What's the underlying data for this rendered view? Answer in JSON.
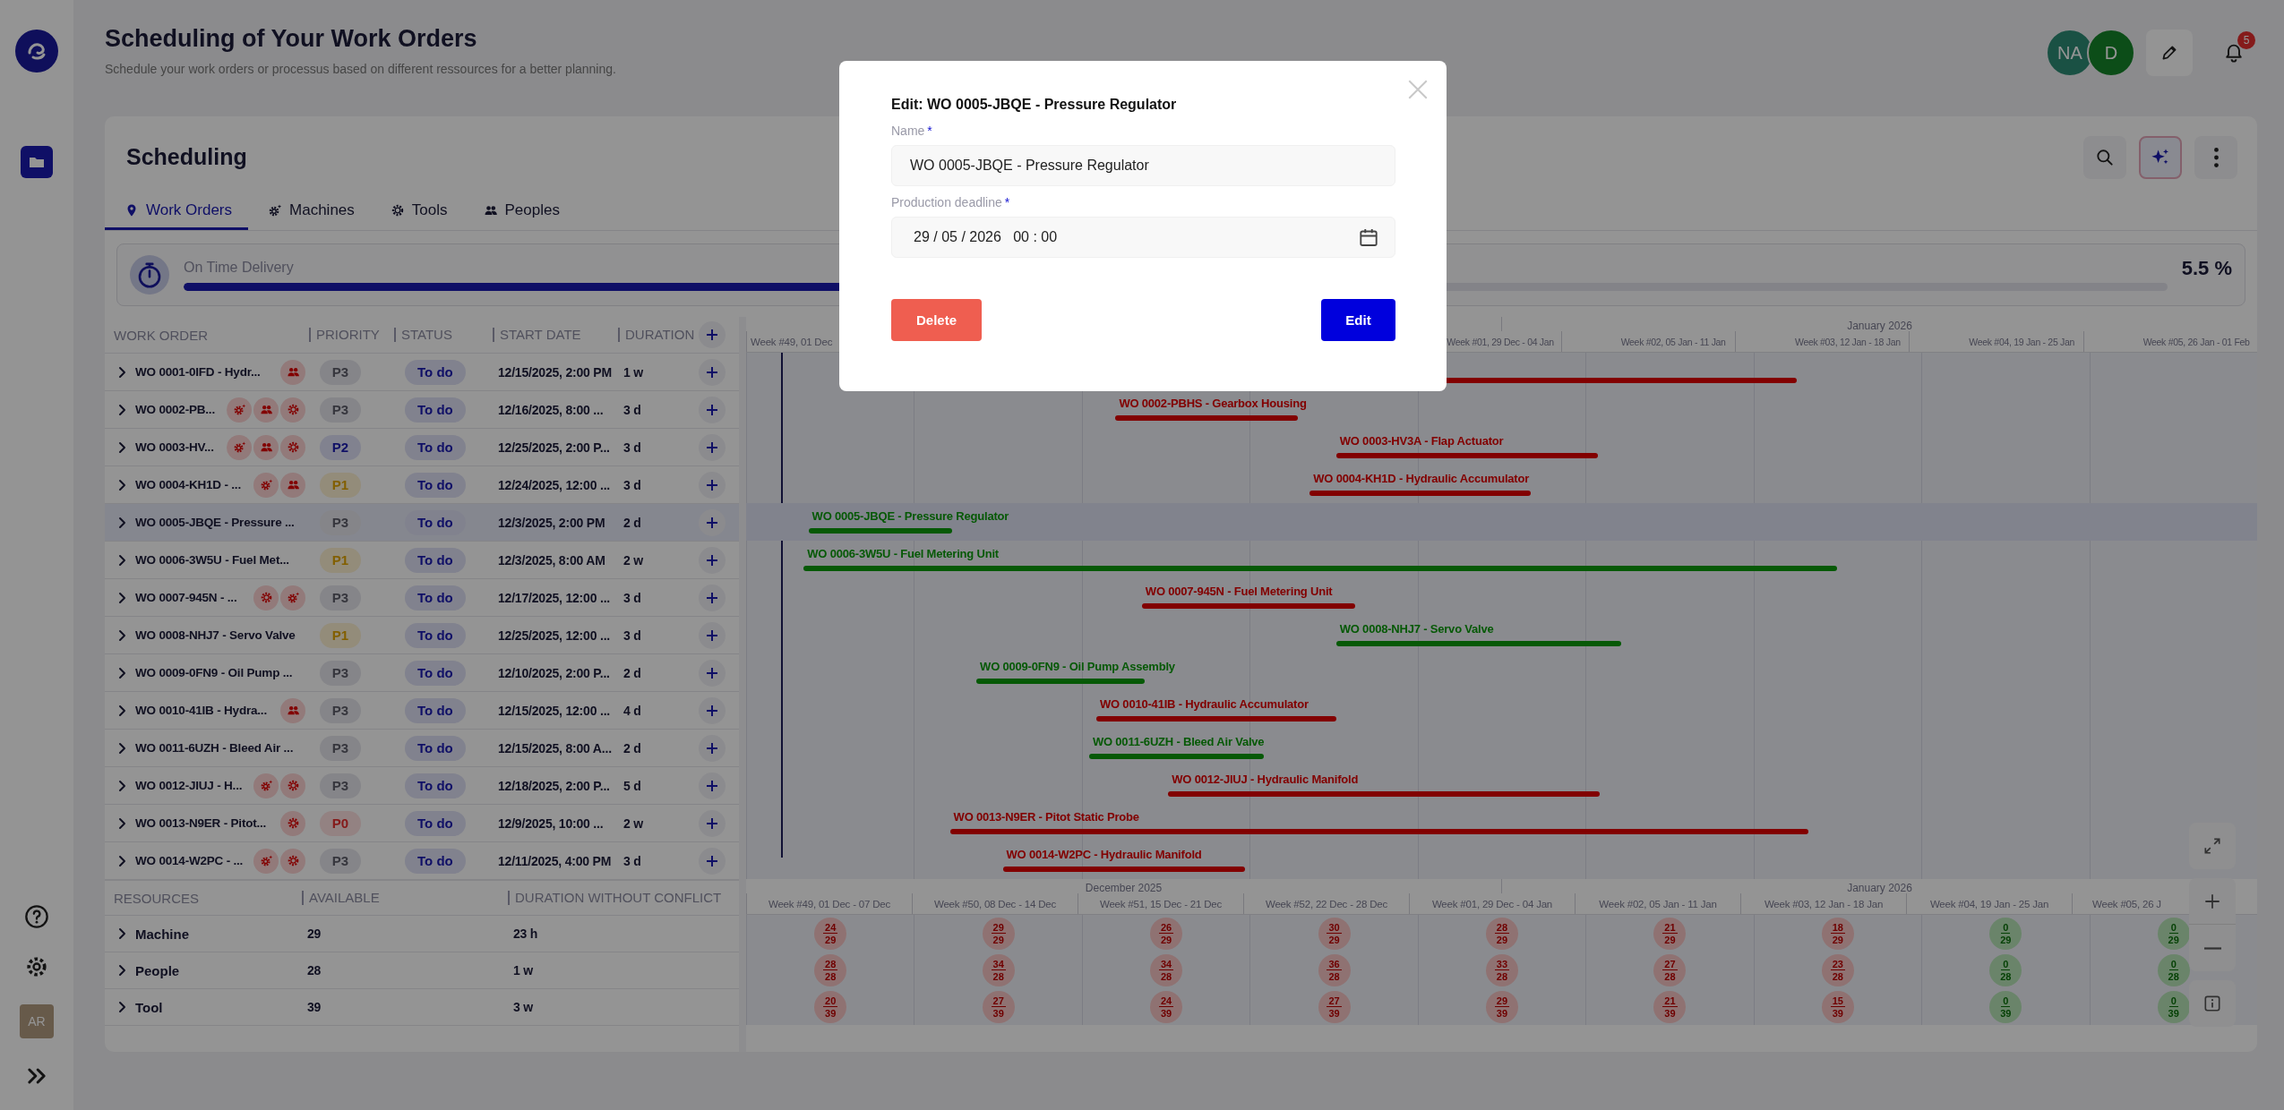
{
  "sidebar": {
    "avatar": "AR"
  },
  "header": {
    "title": "Scheduling of Your Work Orders",
    "subtitle": "Schedule your work orders or processus based on different ressources for a better planning.",
    "users": [
      {
        "initials": "NA"
      },
      {
        "initials": "D"
      }
    ],
    "notifications": "5"
  },
  "scheduling": {
    "title": "Scheduling",
    "tabs": [
      {
        "label": "Work Orders",
        "kind": "pin",
        "selected": true
      },
      {
        "label": "Machines",
        "kind": "machine",
        "selected": false
      },
      {
        "label": "Tools",
        "kind": "tool",
        "selected": false
      },
      {
        "label": "Peoples",
        "kind": "people",
        "selected": false
      }
    ],
    "on_time_delivery": {
      "label": "On Time Delivery",
      "level": 0.42,
      "reading": "5.5 %"
    },
    "work_orders": {
      "columns": [
        "WORK ORDER",
        "PRIORITY",
        "STATUS",
        "START DATE",
        "DURATION"
      ],
      "rows": [
        {
          "name": "WO 0001-0IFD - Hydr...",
          "resources": [
            {
              "kind": "people"
            }
          ],
          "priority": {
            "label": "P3",
            "kind": "low"
          },
          "status": "To do",
          "start": "12/15/2025, 2:00 PM",
          "duration": "1 w",
          "selected": false
        },
        {
          "name": "WO 0002-PB...",
          "resources": [
            {
              "kind": "machine"
            },
            {
              "kind": "people"
            },
            {
              "kind": "tool"
            }
          ],
          "priority": {
            "label": "P3",
            "kind": "low"
          },
          "status": "To do",
          "start": "12/16/2025, 8:00 ...",
          "duration": "3 d",
          "selected": false
        },
        {
          "name": "WO 0003-HV...",
          "resources": [
            {
              "kind": "machine"
            },
            {
              "kind": "people"
            },
            {
              "kind": "tool"
            }
          ],
          "priority": {
            "label": "P2",
            "kind": "medium"
          },
          "status": "To do",
          "start": "12/25/2025, 2:00 P...",
          "duration": "3 d",
          "selected": false
        },
        {
          "name": "WO 0004-KH1D - ...",
          "resources": [
            {
              "kind": "machine"
            },
            {
              "kind": "people"
            }
          ],
          "priority": {
            "label": "P1",
            "kind": "high"
          },
          "status": "To do",
          "start": "12/24/2025, 12:00 ...",
          "duration": "3 d",
          "selected": false
        },
        {
          "name": "WO 0005-JBQE - Pressure ...",
          "resources": [],
          "priority": {
            "label": "P3",
            "kind": "low"
          },
          "status": "To do",
          "start": "12/3/2025, 2:00 PM",
          "duration": "2 d",
          "selected": true
        },
        {
          "name": "WO 0006-3W5U - Fuel Met...",
          "resources": [],
          "priority": {
            "label": "P1",
            "kind": "high"
          },
          "status": "To do",
          "start": "12/3/2025, 8:00 AM",
          "duration": "2 w",
          "selected": false
        },
        {
          "name": "WO 0007-945N - ...",
          "resources": [
            {
              "kind": "tool"
            },
            {
              "kind": "machine"
            }
          ],
          "priority": {
            "label": "P3",
            "kind": "low"
          },
          "status": "To do",
          "start": "12/17/2025, 12:00 ...",
          "duration": "3 d",
          "selected": false
        },
        {
          "name": "WO 0008-NHJ7 - Servo Valve",
          "resources": [],
          "priority": {
            "label": "P1",
            "kind": "high"
          },
          "status": "To do",
          "start": "12/25/2025, 12:00 ...",
          "duration": "3 d",
          "selected": false
        },
        {
          "name": "WO 0009-0FN9 - Oil Pump ...",
          "resources": [],
          "priority": {
            "label": "P3",
            "kind": "low"
          },
          "status": "To do",
          "start": "12/10/2025, 2:00 P...",
          "duration": "2 d",
          "selected": false
        },
        {
          "name": "WO 0010-41IB - Hydra...",
          "resources": [
            {
              "kind": "people"
            }
          ],
          "priority": {
            "label": "P3",
            "kind": "low"
          },
          "status": "To do",
          "start": "12/15/2025, 12:00 ...",
          "duration": "4 d",
          "selected": false
        },
        {
          "name": "WO 0011-6UZH - Bleed Air ...",
          "resources": [],
          "priority": {
            "label": "P3",
            "kind": "low"
          },
          "status": "To do",
          "start": "12/15/2025, 8:00 A...",
          "duration": "2 d",
          "selected": false
        },
        {
          "name": "WO 0012-JIUJ - H...",
          "resources": [
            {
              "kind": "machine"
            },
            {
              "kind": "tool"
            }
          ],
          "priority": {
            "label": "P3",
            "kind": "low"
          },
          "status": "To do",
          "start": "12/18/2025, 2:00 P...",
          "duration": "5 d",
          "selected": false
        },
        {
          "name": "WO 0013-N9ER - Pitot...",
          "resources": [
            {
              "kind": "tool"
            }
          ],
          "priority": {
            "label": "P0",
            "kind": "critical"
          },
          "status": "To do",
          "start": "12/9/2025, 10:00 ...",
          "duration": "2 w",
          "selected": false
        },
        {
          "name": "WO 0014-W2PC - ...",
          "resources": [
            {
              "kind": "machine"
            },
            {
              "kind": "tool"
            }
          ],
          "priority": {
            "label": "P3",
            "kind": "low"
          },
          "status": "To do",
          "start": "12/11/2025, 4:00 PM",
          "duration": "3 d",
          "selected": false
        }
      ]
    },
    "gantt": {
      "header_months": [
        "January 2026"
      ],
      "header_weeks": [
        "Week #49, 01 Dec",
        "Week #01, 29 Dec - 04 Jan",
        "Week #02, 05 Jan - 11 Jan",
        "Week #03, 12 Jan - 18 Jan",
        "Week #04, 19 Jan - 25 Jan",
        "Week #05, 26 Jan - 01 Feb"
      ],
      "tasks": [
        {
          "late": true
        },
        {
          "label": "WO 0002-PBHS - Gearbox Housing",
          "late": true
        },
        {
          "label": "WO 0003-HV3A - Flap Actuator",
          "late": true
        },
        {
          "label": "WO 0004-KH1D - Hydraulic Accumulator",
          "late": true
        },
        {
          "label": "WO 0005-JBQE - Pressure Regulator",
          "late": false
        },
        {
          "label": "WO 0006-3W5U - Fuel Metering Unit",
          "late": false
        },
        {
          "label": "WO 0007-945N - Fuel Metering Unit",
          "late": true
        },
        {
          "label": "WO 0008-NHJ7 - Servo Valve",
          "late": false
        },
        {
          "label": "WO 0009-0FN9 - Oil Pump Assembly",
          "late": false
        },
        {
          "label": "WO 0010-41IB - Hydraulic Accumulator",
          "late": true
        },
        {
          "label": "WO 0011-6UZH - Bleed Air Valve",
          "late": false
        },
        {
          "label": "WO 0012-JIUJ - Hydraulic Manifold",
          "late": true
        },
        {
          "label": "WO 0013-N9ER - Pitot Static Probe",
          "late": true
        },
        {
          "label": "WO 0014-W2PC - Hydraulic Manifold",
          "late": true
        }
      ]
    },
    "resources": {
      "columns": [
        "RESOURCES",
        "AVAILABLE",
        "DURATION WITHOUT CONFLICT"
      ],
      "months": [
        "December 2025",
        "January 2026"
      ],
      "weeks": [
        "Week #49, 01 Dec - 07 Dec",
        "Week #50, 08 Dec - 14 Dec",
        "Week #51, 15 Dec - 21 Dec",
        "Week #52, 22 Dec - 28 Dec",
        "Week #01, 29 Dec - 04 Jan",
        "Week #02, 05 Jan - 11 Jan",
        "Week #03, 12 Jan - 18 Jan",
        "Week #04, 19 Jan - 25 Jan",
        "Week #05, 26 J"
      ],
      "rows": [
        {
          "name": "Machine",
          "available": "29",
          "duration": "23 h",
          "loads": [
            {
              "used": "24",
              "capacity": "29",
              "conflict": true
            },
            {
              "used": "29",
              "capacity": "29",
              "conflict": true
            },
            {
              "used": "26",
              "capacity": "29",
              "conflict": true
            },
            {
              "used": "30",
              "capacity": "29",
              "conflict": true
            },
            {
              "used": "28",
              "capacity": "29",
              "conflict": true
            },
            {
              "used": "21",
              "capacity": "29",
              "conflict": true
            },
            {
              "used": "18",
              "capacity": "29",
              "conflict": true
            },
            {
              "used": "0",
              "capacity": "29",
              "conflict": false
            },
            {
              "used": "0",
              "capacity": "29",
              "conflict": false
            }
          ]
        },
        {
          "name": "People",
          "available": "28",
          "duration": "1 w",
          "loads": [
            {
              "used": "28",
              "capacity": "28",
              "conflict": true
            },
            {
              "used": "34",
              "capacity": "28",
              "conflict": true
            },
            {
              "used": "34",
              "capacity": "28",
              "conflict": true
            },
            {
              "used": "36",
              "capacity": "28",
              "conflict": true
            },
            {
              "used": "33",
              "capacity": "28",
              "conflict": true
            },
            {
              "used": "27",
              "capacity": "28",
              "conflict": true
            },
            {
              "used": "23",
              "capacity": "28",
              "conflict": true
            },
            {
              "used": "0",
              "capacity": "28",
              "conflict": false
            },
            {
              "used": "0",
              "capacity": "28",
              "conflict": false
            }
          ]
        },
        {
          "name": "Tool",
          "available": "39",
          "duration": "3 w",
          "loads": [
            {
              "used": "20",
              "capacity": "39",
              "conflict": true
            },
            {
              "used": "27",
              "capacity": "39",
              "conflict": true
            },
            {
              "used": "24",
              "capacity": "39",
              "conflict": true
            },
            {
              "used": "27",
              "capacity": "39",
              "conflict": true
            },
            {
              "used": "29",
              "capacity": "39",
              "conflict": true
            },
            {
              "used": "21",
              "capacity": "39",
              "conflict": true
            },
            {
              "used": "15",
              "capacity": "39",
              "conflict": true
            },
            {
              "used": "0",
              "capacity": "39",
              "conflict": false
            },
            {
              "used": "0",
              "capacity": "39",
              "conflict": false
            }
          ]
        }
      ]
    }
  },
  "modal": {
    "title": "Edit: WO 0005-JBQE - Pressure Regulator",
    "fields": [
      {
        "label": "Name",
        "required_mark": "*",
        "kind": "text",
        "value": "WO 0005-JBQE - Pressure Regulator"
      },
      {
        "label": "Production deadline",
        "required_mark": "*",
        "kind": "datetime",
        "value": "29 / 05 / 2026   00 : 00"
      }
    ],
    "buttons": [
      {
        "label": "Delete",
        "kind": "danger"
      },
      {
        "label": "Edit",
        "kind": "primary"
      }
    ]
  }
}
